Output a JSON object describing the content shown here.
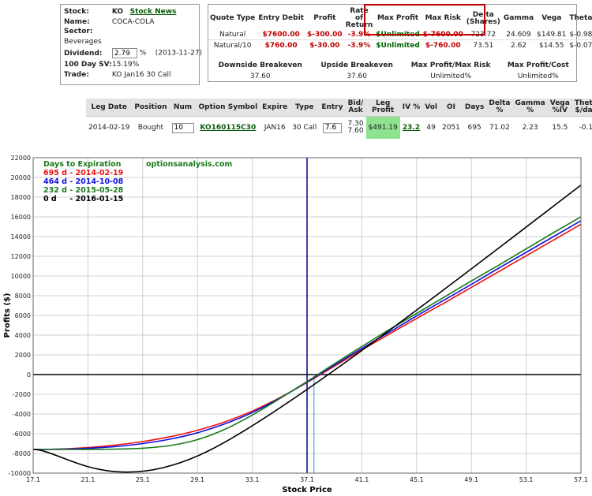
{
  "stock": {
    "labels": {
      "stock": "Stock:",
      "name": "Name:",
      "sector": "Sector:",
      "dividend": "Dividend:",
      "sv": "100 Day SV:",
      "trade": "Trade:"
    },
    "symbol": "KO",
    "news_link": "Stock News",
    "name": "COCA-COLA",
    "sector": "Beverages",
    "dividend_value": "2.79",
    "dividend_unit": "%",
    "dividend_date": "(2013-11-27)",
    "sv": "15.19%",
    "trade": "KO Jan16 30 Call"
  },
  "quote": {
    "headers": [
      "Quote Type",
      "Entry Debit",
      "Profit",
      "Rate of Return",
      "Max Profit",
      "Max Risk",
      "Delta (Shares)",
      "Gamma",
      "Vega",
      "Theta"
    ],
    "rows": [
      [
        "Natural",
        "$7600.00",
        "$-300.00",
        "-3.9%",
        "$Unlimited",
        "$-7600.00",
        "723.72",
        "24.609",
        "$149.81",
        "$-0.98"
      ],
      [
        "Natural/10",
        "$760.00",
        "$-30.00",
        "-3.9%",
        "$Unlimited",
        "$-760.00",
        "73.51",
        "2.62",
        "$14.55",
        "$-0.07"
      ]
    ],
    "breakeven_headers": [
      "Downside Breakeven",
      "Upside Breakeven",
      "Max Profit/Max Risk",
      "Max Profit/Cost"
    ],
    "breakeven_values": [
      "37.60",
      "37.60",
      "Unlimited%",
      "Unlimited%"
    ]
  },
  "leg": {
    "headers": [
      "Leg Date",
      "Position",
      "Num",
      "Option Symbol",
      "Expire",
      "Type",
      "Entry",
      "Bid/ Ask",
      "Leg Profit",
      "IV %",
      "Vol",
      "OI",
      "Days",
      "Delta %",
      "Gamma %",
      "Vega %IV",
      "Theta $/day"
    ],
    "row": {
      "date": "2014-02-19",
      "position": "Bought",
      "num": "10",
      "symbol": "KO160115C30",
      "expire": "JAN16",
      "type": "30 Call",
      "entry": "7.6",
      "bid": "7.30",
      "ask": "7.60",
      "leg_profit": "$491.19",
      "iv": "23.2",
      "vol": "49",
      "oi": "2051",
      "days": "695",
      "delta": "71.02",
      "gamma": "2.23",
      "vega": "15.5",
      "theta": "-0.1"
    }
  },
  "chart_data": {
    "type": "line",
    "xlabel": "Stock Price",
    "ylabel": "Profits ($)",
    "watermark": "optionsanalysis.com",
    "legend_title": "Days to Expiration",
    "legend_placement": "top-left",
    "grid": true,
    "xlim": [
      17.1,
      57.1
    ],
    "ylim": [
      -10000,
      22000
    ],
    "xticks": [
      17.1,
      21.1,
      25.1,
      29.1,
      33.1,
      37.1,
      41.1,
      45.1,
      49.1,
      53.1,
      57.1
    ],
    "yticks": [
      -10000,
      -8000,
      -6000,
      -4000,
      -2000,
      0,
      2000,
      4000,
      6000,
      8000,
      10000,
      12000,
      14000,
      16000,
      18000,
      20000,
      22000
    ],
    "current_price_line": 37.1,
    "breakeven_line": 37.6,
    "colors": {
      "current_price_line": "#00008b",
      "breakeven_line": "#66b3e6",
      "zero_line": "#000000"
    },
    "series": [
      {
        "name": "695 d - 2014-02-19",
        "color": "#ee1111",
        "points": [
          [
            17.1,
            -7600
          ],
          [
            19.1,
            -7550
          ],
          [
            21.1,
            -7400
          ],
          [
            23.1,
            -7150
          ],
          [
            25.1,
            -6800
          ],
          [
            27.1,
            -6300
          ],
          [
            29.1,
            -5650
          ],
          [
            31.1,
            -4800
          ],
          [
            33.1,
            -3700
          ],
          [
            35.1,
            -2350
          ],
          [
            37.1,
            -800
          ],
          [
            39.1,
            850
          ],
          [
            41.1,
            2500
          ],
          [
            43.1,
            4100
          ],
          [
            45.1,
            5700
          ],
          [
            47.1,
            7250
          ],
          [
            49.1,
            8850
          ],
          [
            51.1,
            10450
          ],
          [
            53.1,
            12050
          ],
          [
            55.1,
            13650
          ],
          [
            57.1,
            15250
          ],
          [
            59.1,
            16800
          ],
          [
            61.1,
            18200
          ]
        ]
      },
      {
        "name": "464 d - 2014-10-08",
        "color": "#1111dd",
        "points": [
          [
            17.1,
            -7600
          ],
          [
            19.1,
            -7570
          ],
          [
            21.1,
            -7480
          ],
          [
            23.1,
            -7300
          ],
          [
            25.1,
            -7000
          ],
          [
            27.1,
            -6550
          ],
          [
            29.1,
            -5900
          ],
          [
            31.1,
            -5000
          ],
          [
            33.1,
            -3850
          ],
          [
            35.1,
            -2400
          ],
          [
            37.1,
            -750
          ],
          [
            39.1,
            950
          ],
          [
            41.1,
            2650
          ],
          [
            43.1,
            4300
          ],
          [
            45.1,
            5950
          ],
          [
            47.1,
            7550
          ],
          [
            49.1,
            9150
          ],
          [
            51.1,
            10800
          ],
          [
            53.1,
            12400
          ],
          [
            55.1,
            14000
          ],
          [
            57.1,
            15600
          ],
          [
            59.1,
            17150
          ],
          [
            61.1,
            18600
          ]
        ]
      },
      {
        "name": "232 d - 2015-05-28",
        "color": "#1a7a1a",
        "points": [
          [
            17.1,
            -7600
          ],
          [
            19.1,
            -7598
          ],
          [
            21.1,
            -7590
          ],
          [
            23.1,
            -7560
          ],
          [
            25.1,
            -7470
          ],
          [
            27.1,
            -7200
          ],
          [
            29.1,
            -6600
          ],
          [
            31.1,
            -5550
          ],
          [
            33.1,
            -4100
          ],
          [
            35.1,
            -2450
          ],
          [
            37.1,
            -700
          ],
          [
            39.1,
            1100
          ],
          [
            41.1,
            2850
          ],
          [
            43.1,
            4550
          ],
          [
            45.1,
            6200
          ],
          [
            47.1,
            7850
          ],
          [
            49.1,
            9500
          ],
          [
            51.1,
            11100
          ],
          [
            53.1,
            12750
          ],
          [
            55.1,
            14400
          ],
          [
            57.1,
            16000
          ],
          [
            59.1,
            17550
          ],
          [
            61.1,
            19000
          ]
        ]
      },
      {
        "name": "0 d     - 2016-01-15",
        "color": "#000000",
        "points": [
          [
            17.1,
            -7600
          ],
          [
            30.1,
            -7600
          ],
          [
            61.1,
            23400
          ]
        ]
      }
    ]
  }
}
